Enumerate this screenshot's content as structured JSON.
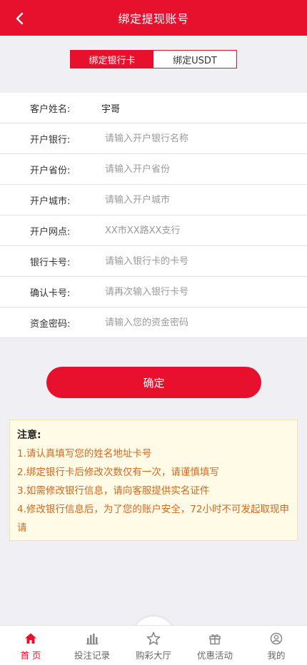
{
  "header": {
    "title": "绑定提现账号"
  },
  "tabs": [
    {
      "label": "绑定银行卡",
      "active": true
    },
    {
      "label": "绑定USDT",
      "active": false
    }
  ],
  "form": {
    "name": {
      "label": "客户姓名:",
      "value": "宇哥"
    },
    "bank": {
      "label": "开户银行:",
      "placeholder": "请输入开户银行名称"
    },
    "province": {
      "label": "开户省份:",
      "placeholder": "请输入开户省份"
    },
    "city": {
      "label": "开户城市:",
      "placeholder": "请输入开户城市"
    },
    "branch": {
      "label": "开户网点:",
      "placeholder": "XX市XX路XX支行"
    },
    "card": {
      "label": "银行卡号:",
      "placeholder": "请输入银行卡的卡号"
    },
    "card_confirm": {
      "label": "确认卡号:",
      "placeholder": "请再次输入银行卡号"
    },
    "password": {
      "label": "资金密码:",
      "placeholder": "请输入您的资金密码"
    }
  },
  "submit_label": "确定",
  "notice": {
    "title": "注意:",
    "lines": [
      "1.请认真填写您的姓名地址卡号",
      "2.绑定银行卡后修改次数仅有一次，请谨慎填写",
      "3.如需修改银行信息，请向客服提供实名证件",
      "4.修改银行信息后，为了您的账户安全，72小时不可发起取现申请"
    ]
  },
  "tabbar": [
    {
      "label": "首 页",
      "icon": "home-icon",
      "active": true
    },
    {
      "label": "投注记录",
      "icon": "chart-icon",
      "active": false
    },
    {
      "label": "购彩大厅",
      "icon": "star-icon",
      "active": false
    },
    {
      "label": "优惠活动",
      "icon": "gift-icon",
      "active": false
    },
    {
      "label": "我的",
      "icon": "user-icon",
      "active": false
    }
  ],
  "colors": {
    "brand": "#e8112d",
    "notice_text": "#d2691e",
    "notice_bg": "#fffbe6"
  }
}
